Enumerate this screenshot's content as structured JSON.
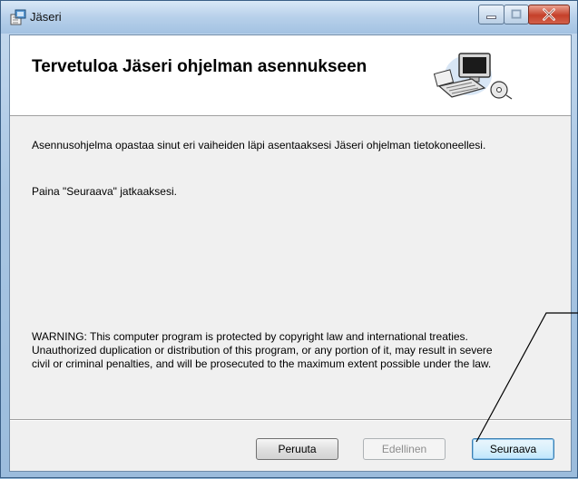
{
  "window": {
    "title": "Jäseri",
    "icon": "installer-icon",
    "controls": [
      "minimize-icon",
      "maximize-icon",
      "close-icon"
    ]
  },
  "banner": {
    "title": "Tervetuloa Jäseri ohjelman asennukseen",
    "art": "computer-setup-icon"
  },
  "content": {
    "intro": "Asennusohjelma opastaa sinut eri vaiheiden läpi asentaaksesi Jäseri ohjelman tietokoneellesi.",
    "instruction": "Paina \"Seuraava\" jatkaaksesi.",
    "warning": [
      "WARNING: This computer program is protected by copyright law and international treaties.",
      "Unauthorized duplication or distribution of this program, or any portion of it, may result in severe",
      "civil or criminal penalties, and will be prosecuted to the maximum extent possible under the law."
    ]
  },
  "buttons": {
    "cancel": "Peruuta",
    "back": "Edellinen",
    "next": "Seuraava"
  },
  "colors": {
    "accent": "#3c7fb1",
    "close": "#c5402a"
  }
}
